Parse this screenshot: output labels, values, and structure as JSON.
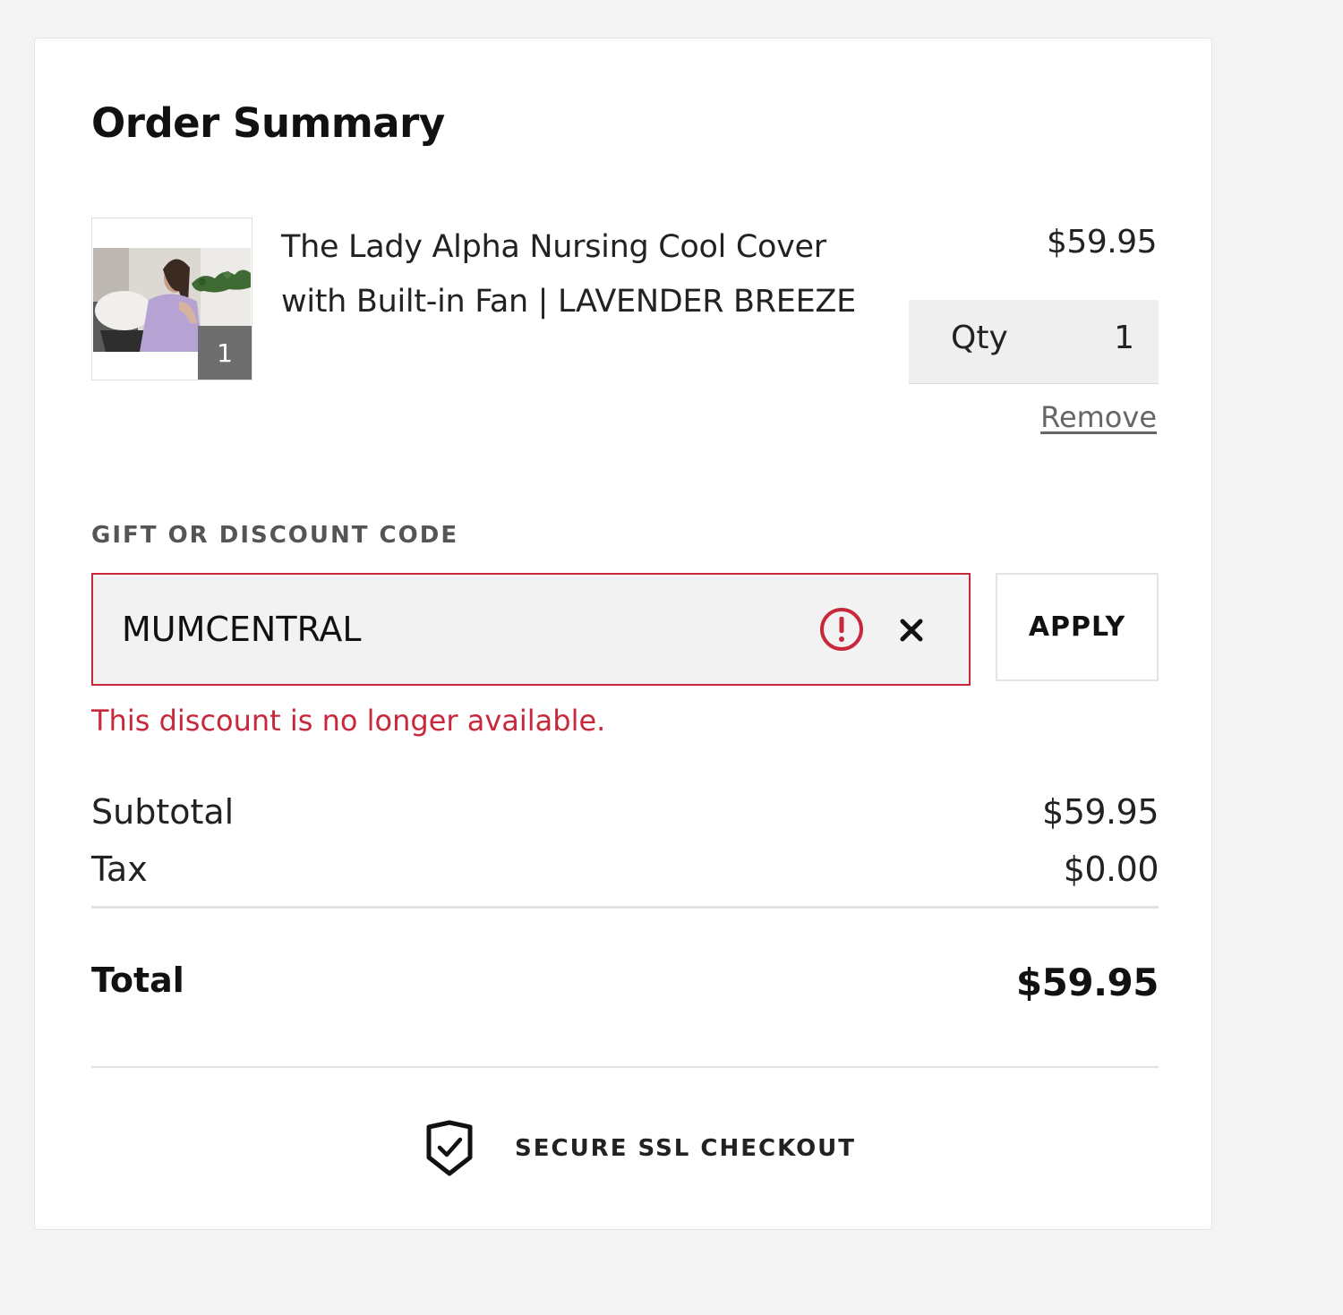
{
  "order_summary": {
    "title": "Order Summary"
  },
  "cart_item": {
    "name": "The Lady Alpha Nursing Cool Cover with Built-in Fan | LAVENDER BREEZE",
    "price": "$59.95",
    "thumbnail_badge": "1",
    "qty_label": "Qty",
    "qty_value": "1",
    "remove_label": "Remove"
  },
  "discount": {
    "label": "GIFT OR DISCOUNT CODE",
    "code_value": "MUMCENTRAL",
    "apply_label": "APPLY",
    "error_message": "This discount is no longer available.",
    "error_color": "#c8283c"
  },
  "totals": {
    "subtotal_label": "Subtotal",
    "subtotal_value": "$59.95",
    "tax_label": "Tax",
    "tax_value": "$0.00",
    "total_label": "Total",
    "total_value": "$59.95"
  },
  "security": {
    "icon": "shield-check-icon",
    "text": "SECURE SSL CHECKOUT"
  }
}
